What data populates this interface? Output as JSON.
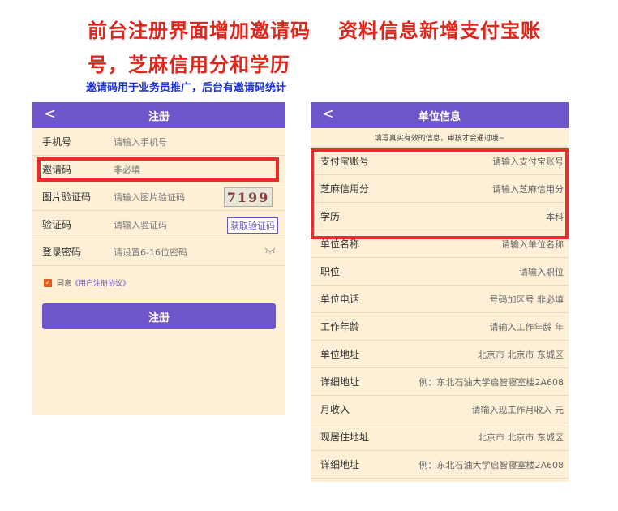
{
  "headline": {
    "line1_left": "前台注册界面增加邀请码",
    "line1_right": "资料信息新增支付宝账",
    "line2": "号，芝麻信用分和学历",
    "subline": "邀请码用于业务员推广，后台有邀请码统计"
  },
  "register": {
    "back": "<",
    "title": "注册",
    "phone_label": "手机号",
    "phone_placeholder": "请输入手机号",
    "invite_label": "邀请码",
    "invite_placeholder": "非必填",
    "imgcode_label": "图片验证码",
    "imgcode_placeholder": "请输入图片验证码",
    "captcha_text": "7199",
    "code_label": "验证码",
    "code_placeholder": "请输入验证码",
    "get_code": "获取验证码",
    "password_label": "登录密码",
    "password_placeholder": "请设置6-16位密码",
    "agree_prefix": "同意",
    "agree_link": "《用户注册协议》",
    "submit": "注册"
  },
  "unit": {
    "back": "<",
    "title": "单位信息",
    "notice": "填写真实有效的信息，审核才会通过哦~",
    "rows": [
      {
        "label": "支付宝账号",
        "value": "请输入支付宝账号"
      },
      {
        "label": "芝麻信用分",
        "value": "请输入芝麻信用分"
      },
      {
        "label": "学历",
        "value": "本科"
      },
      {
        "label": "单位名称",
        "value": "请输入单位名称"
      },
      {
        "label": "职位",
        "value": "请输入职位"
      },
      {
        "label": "单位电话",
        "value": "号码加区号 非必填"
      },
      {
        "label": "工作年龄",
        "value": "请输入工作年龄  年"
      },
      {
        "label": "单位地址",
        "value": "北京市 北京市 东城区"
      },
      {
        "label": "详细地址",
        "value": "例：东北石油大学启智寝室楼2A608"
      },
      {
        "label": "月收入",
        "value": "请输入现工作月收入  元"
      },
      {
        "label": "现居住地址",
        "value": "北京市 北京市 东城区"
      },
      {
        "label": "详细地址",
        "value": "例：东北石油大学启智寝室楼2A608"
      }
    ]
  },
  "colors": {
    "accent": "#6e55c9",
    "highlight": "#ea2c2c",
    "headline": "#e0251b",
    "subline": "#1a2fd6",
    "panel": "#fdf0d6"
  }
}
